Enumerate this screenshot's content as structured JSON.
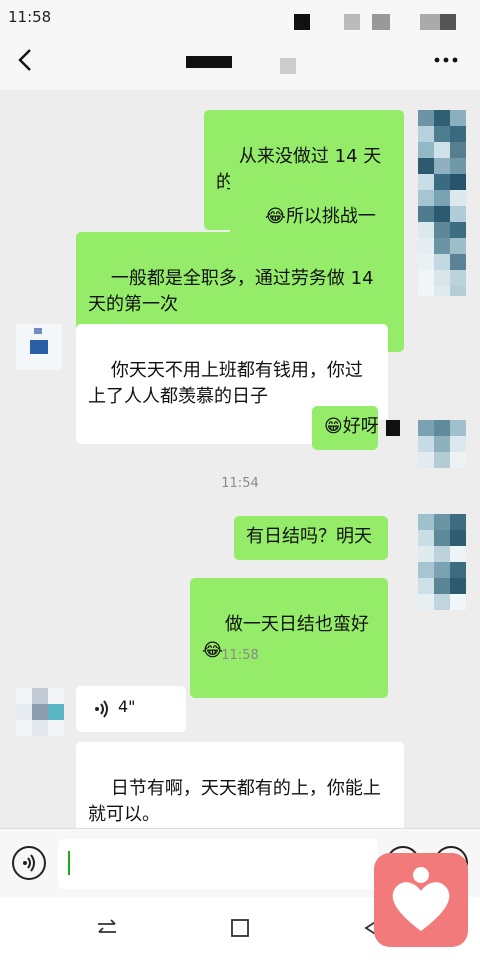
{
  "status_bar": {
    "time": "11:58"
  },
  "title_bar": {
    "back_icon": "chevron-left",
    "more_icon": "more-dots"
  },
  "messages": [
    {
      "id": "m1",
      "side": "out",
      "text": "从来没做过 14 天的"
    },
    {
      "id": "m2",
      "side": "out",
      "emoji": "😂",
      "text": "所以挑战一下"
    },
    {
      "id": "m3",
      "side": "out",
      "text": "一般都是全职多，通过劳务做 14 天的第一次"
    },
    {
      "id": "m4",
      "side": "in",
      "text": "你天天不用上班都有钱用，你过上了人人都羡慕的日子"
    },
    {
      "id": "m5",
      "side": "out",
      "emoji": "😁",
      "text": "好呀"
    },
    {
      "id": "m6",
      "side": "out",
      "text": "有日结吗？明天"
    },
    {
      "id": "m7",
      "side": "out",
      "text": "做一天日结也蛮好",
      "emoji": "😂"
    },
    {
      "id": "m8",
      "side": "in",
      "type": "voice",
      "duration": "4\""
    },
    {
      "id": "m9",
      "side": "in",
      "text": "日节有啊，天天都有的上，你能上就可以。"
    }
  ],
  "timestamps": [
    "11:54",
    "11:58"
  ],
  "input_bar": {
    "placeholder": "",
    "voice_icon": "voice-icon",
    "emoji_icon": "emoji-icon",
    "plus_icon": "plus-icon"
  },
  "nav_bar": {
    "icons": [
      "switch-icon",
      "square-icon",
      "back-triangle-icon"
    ]
  },
  "colors": {
    "out_bubble": "#95ec69",
    "in_bubble": "#ffffff",
    "background": "#ededed",
    "accent": "#1aad19"
  }
}
